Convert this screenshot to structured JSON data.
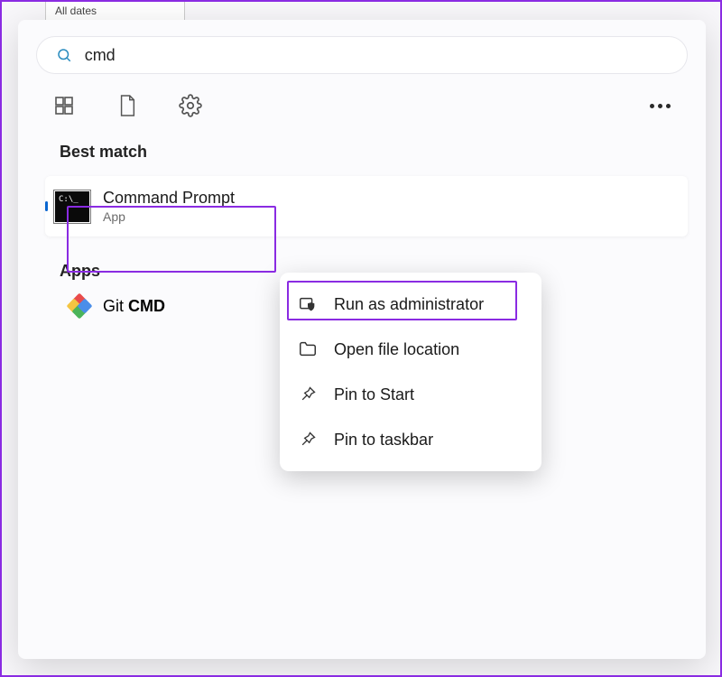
{
  "bg": {
    "tabLabel": "All dates"
  },
  "search": {
    "value": "cmd"
  },
  "sections": {
    "bestMatch": "Best match",
    "apps": "Apps"
  },
  "bestMatch": {
    "title": "Command Prompt",
    "subtitle": "App"
  },
  "appsList": [
    {
      "prefix": "Git ",
      "bold": "CMD"
    }
  ],
  "contextMenu": {
    "items": [
      {
        "label": "Run as administrator",
        "icon": "admin"
      },
      {
        "label": "Open file location",
        "icon": "folder"
      },
      {
        "label": "Pin to Start",
        "icon": "pin"
      },
      {
        "label": "Pin to taskbar",
        "icon": "pin"
      }
    ]
  },
  "colors": {
    "accent": "#8a2be2"
  }
}
